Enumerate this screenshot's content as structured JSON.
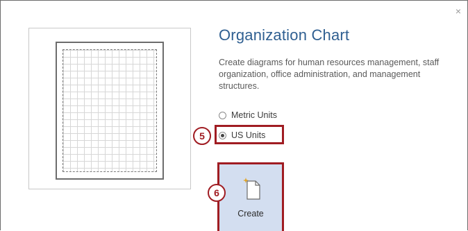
{
  "dialog": {
    "title": "Organization Chart",
    "description": "Create diagrams for human resources management, staff organization, office administration, and management structures.",
    "close_icon": "close-icon"
  },
  "units": {
    "metric_label": "Metric Units",
    "us_label": "US Units",
    "selected": "US Units"
  },
  "create_button": {
    "label": "Create",
    "icon": "new-document-icon"
  },
  "callouts": {
    "step_5": "5",
    "step_6": "6"
  },
  "colors": {
    "title": "#2f5f91",
    "highlight": "#a01c22",
    "create_bg": "#d3def0"
  }
}
